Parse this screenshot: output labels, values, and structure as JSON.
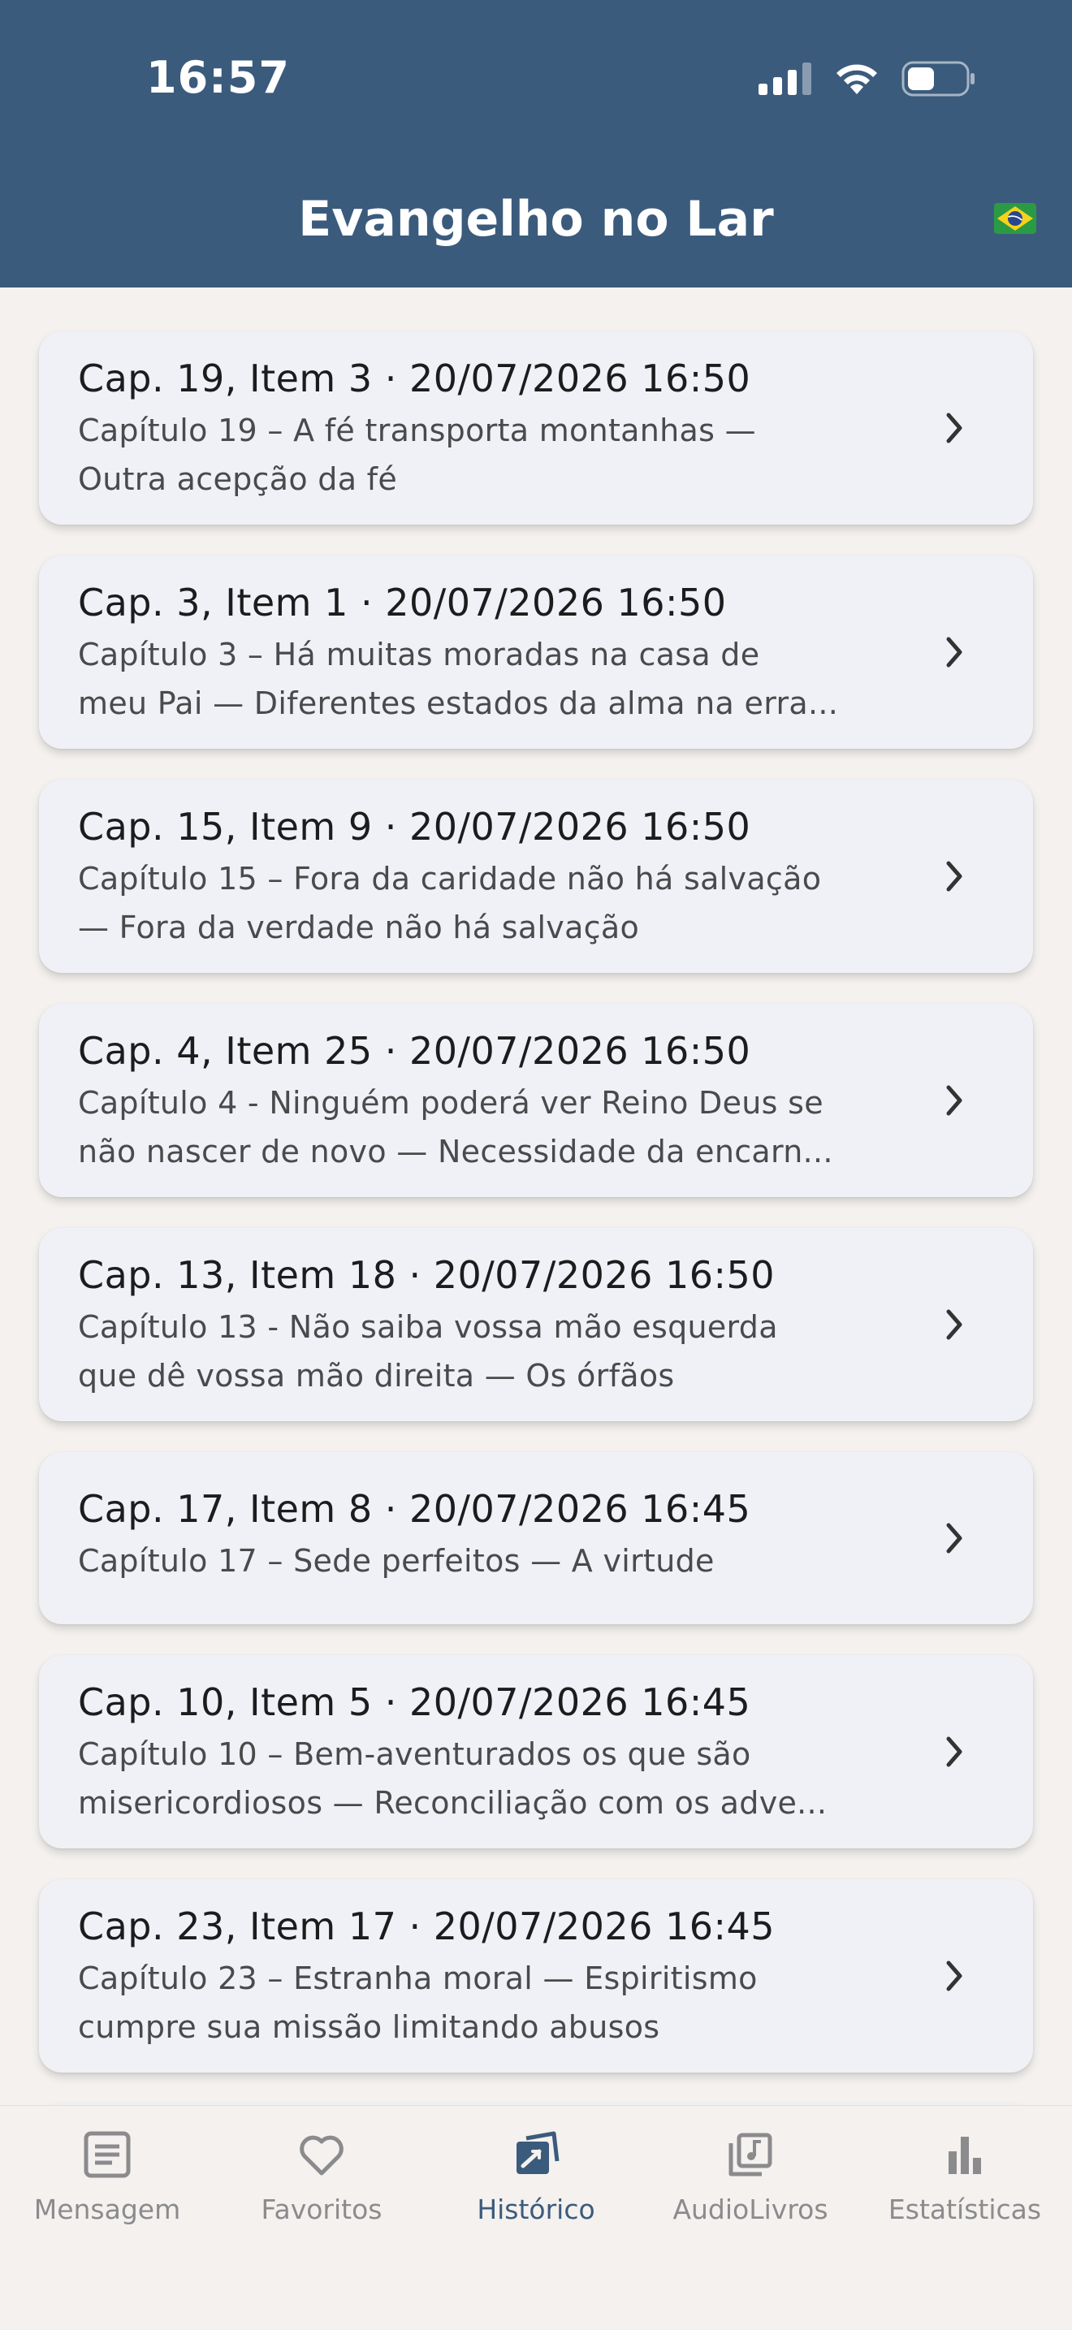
{
  "status_bar": {
    "time": "16:57"
  },
  "header": {
    "title": "Evangelho no Lar",
    "flag_icon": "brazil-flag-icon"
  },
  "history": [
    {
      "title": "Cap. 19, Item 3 · 20/07/2026 16:50",
      "subtitle_line1": "Capítulo 19 – A fé transporta montanhas —",
      "subtitle_line2": "Outra acepção da fé"
    },
    {
      "title": "Cap. 3, Item 1 · 20/07/2026 16:50",
      "subtitle_line1": "Capítulo 3 – Há muitas moradas na casa de",
      "subtitle_line2": "meu Pai — Diferentes estados da alma na erra..."
    },
    {
      "title": "Cap. 15, Item 9 · 20/07/2026 16:50",
      "subtitle_line1": "Capítulo 15 – Fora da caridade não há salvação",
      "subtitle_line2": "— Fora da verdade não há salvação"
    },
    {
      "title": "Cap. 4, Item 25 · 20/07/2026 16:50",
      "subtitle_line1": "Capítulo 4 - Ninguém poderá ver Reino Deus se",
      "subtitle_line2": "não nascer de novo — Necessidade da encarn..."
    },
    {
      "title": "Cap. 13, Item 18 · 20/07/2026 16:50",
      "subtitle_line1": "Capítulo 13 - Não saiba vossa mão esquerda",
      "subtitle_line2": "que dê vossa mão direita — Os órfãos"
    },
    {
      "title": "Cap. 17, Item 8 · 20/07/2026 16:45",
      "subtitle_line1": "Capítulo 17 – Sede perfeitos — A virtude",
      "subtitle_line2": ""
    },
    {
      "title": "Cap. 10, Item 5 · 20/07/2026 16:45",
      "subtitle_line1": "Capítulo 10 – Bem-aventurados os que são",
      "subtitle_line2": "misericordiosos — Reconciliação com os adve..."
    },
    {
      "title": "Cap. 23, Item 17 · 20/07/2026 16:45",
      "subtitle_line1": "Capítulo 23 – Estranha moral — Espiritismo",
      "subtitle_line2": "cumpre sua missão limitando abusos"
    }
  ],
  "tabs": [
    {
      "label": "Mensagem",
      "icon": "article-icon",
      "active": false
    },
    {
      "label": "Favoritos",
      "icon": "heart-icon",
      "active": false
    },
    {
      "label": "Histórico",
      "icon": "history-icon",
      "active": true
    },
    {
      "label": "AudioLivros",
      "icon": "music-library-icon",
      "active": false
    },
    {
      "label": "Estatísticas",
      "icon": "bar-chart-icon",
      "active": false
    }
  ],
  "colors": {
    "header_bg": "#3b5b7d",
    "page_bg": "#f4f1ee",
    "card_bg": "#f0f1f6",
    "active_tab": "#3b5b7d",
    "inactive_tab": "#8b8b8e"
  }
}
